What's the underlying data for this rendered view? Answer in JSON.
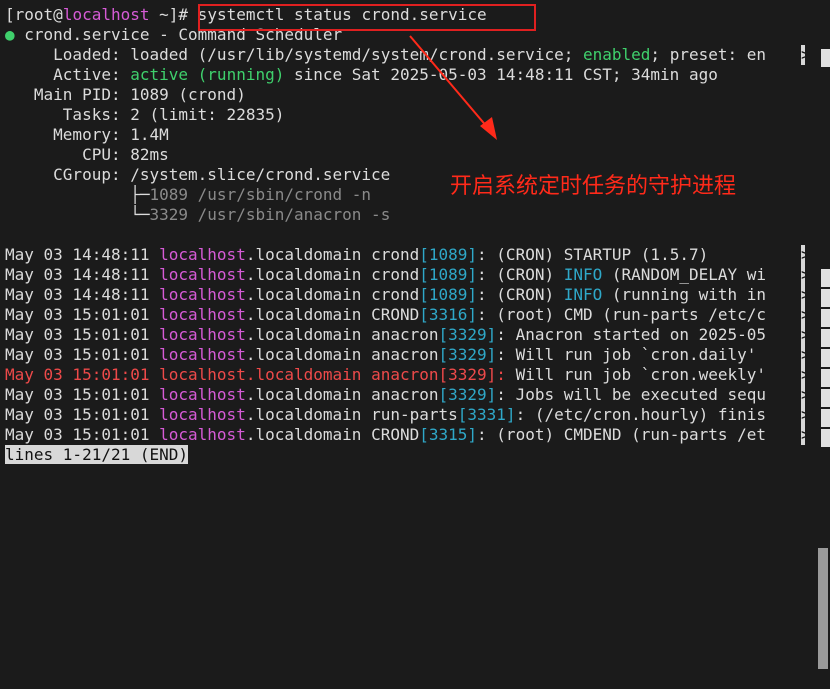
{
  "prompt": {
    "user": "[root",
    "at": "@",
    "host": "localhost",
    "cwd": " ~]#",
    "command": " systemctl status crond.service"
  },
  "service": {
    "bullet": "●",
    "title": " crond.service - Command Scheduler",
    "loaded_label": "     Loaded: ",
    "loaded_value": "loaded (/usr/lib/systemd/system/crond.service; ",
    "loaded_enabled": "enabled",
    "loaded_rest": "; preset: en",
    "active_label": "     Active: ",
    "active_value": "active (running)",
    "active_rest": " since Sat 2025-05-03 14:48:11 CST; 34min ago",
    "mainpid": "   Main PID: 1089 (crond)",
    "tasks": "      Tasks: 2 (limit: 22835)",
    "memory": "     Memory: 1.4M",
    "cpu": "        CPU: 82ms",
    "cgroup": "     CGroup: /system.slice/crond.service",
    "proc1_tree": "             ├─",
    "proc1": "1089 /usr/sbin/crond -n",
    "proc2_tree": "             └─",
    "proc2": "3329 /usr/sbin/anacron -s"
  },
  "logs": [
    {
      "date": "May 03 14:48:11 ",
      "host": "localhost",
      "domain": ".localdomain ",
      "proc": "crond",
      "pid": "[1089]",
      "sep": ": (CRON) ",
      "kw": "",
      "msg": "STARTUP (1.5.7)"
    },
    {
      "date": "May 03 14:48:11 ",
      "host": "localhost",
      "domain": ".localdomain ",
      "proc": "crond",
      "pid": "[1089]",
      "sep": ": (CRON) ",
      "kw": "INFO",
      "msg": " (RANDOM_DELAY wi"
    },
    {
      "date": "May 03 14:48:11 ",
      "host": "localhost",
      "domain": ".localdomain ",
      "proc": "crond",
      "pid": "[1089]",
      "sep": ": (CRON) ",
      "kw": "INFO",
      "msg": " (running with in"
    },
    {
      "date": "May 03 15:01:01 ",
      "host": "localhost",
      "domain": ".localdomain ",
      "proc": "CROND",
      "pid": "[3316]",
      "sep": ": ",
      "kw": "",
      "msg": "(root) CMD (run-parts /etc/c"
    },
    {
      "date": "May 03 15:01:01 ",
      "host": "localhost",
      "domain": ".localdomain ",
      "proc": "anacron",
      "pid": "[3329]",
      "sep": ": ",
      "kw": "",
      "msg": "Anacron started on 2025-05"
    },
    {
      "date": "May 03 15:01:01 ",
      "host": "localhost",
      "domain": ".localdomain ",
      "proc": "anacron",
      "pid": "[3329]",
      "sep": ": ",
      "kw": "",
      "msg": "Will run job `cron.daily'"
    },
    {
      "date": "May 03 15:01:01 ",
      "host": "localhost",
      "domain": ".localdomain ",
      "proc": "anacron",
      "pid": "[3329]",
      "sep": ": ",
      "kw": "",
      "msg": "Will run job `cron.weekly'"
    },
    {
      "date": "May 03 15:01:01 ",
      "host": "localhost",
      "domain": ".localdomain ",
      "proc": "anacron",
      "pid": "[3329]",
      "sep": ": ",
      "kw": "",
      "msg": "Jobs will be executed sequ"
    },
    {
      "date": "May 03 15:01:01 ",
      "host": "localhost",
      "domain": ".localdomain ",
      "proc": "run-parts",
      "pid": "[3331]",
      "sep": ": ",
      "kw": "",
      "msg": "(/etc/cron.hourly) finis"
    },
    {
      "date": "May 03 15:01:01 ",
      "host": "localhost",
      "domain": ".localdomain ",
      "proc": "CROND",
      "pid": "[3315]",
      "sep": ": ",
      "kw": "",
      "msg": "(root) CMDEND (run-parts /et"
    }
  ],
  "overflow_marker": ">",
  "pager_status": "lines 1-21/21 (END)",
  "annotation": "开启系统定时任务的守护进程",
  "colors": {
    "highlight": "#ee4a4a",
    "accent": "#3fd06c",
    "host": "#d65bd6",
    "pid": "#2fa8c8"
  }
}
